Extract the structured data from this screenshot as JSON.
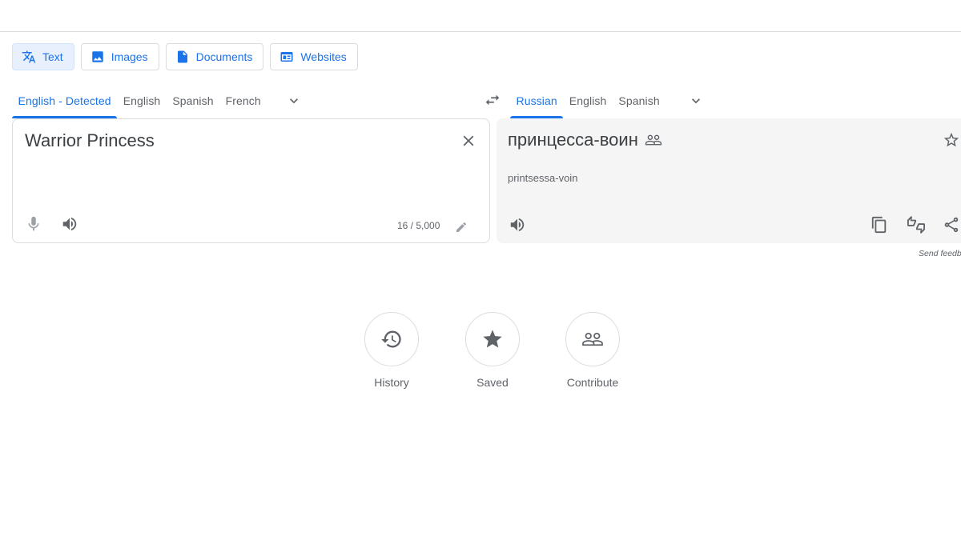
{
  "modes": [
    {
      "label": "Text",
      "icon": "translate-icon",
      "active": true
    },
    {
      "label": "Images",
      "icon": "image-icon",
      "active": false
    },
    {
      "label": "Documents",
      "icon": "document-icon",
      "active": false
    },
    {
      "label": "Websites",
      "icon": "website-icon",
      "active": false
    }
  ],
  "source_languages": [
    {
      "label": "English - Detected",
      "active": true
    },
    {
      "label": "English",
      "active": false
    },
    {
      "label": "Spanish",
      "active": false
    },
    {
      "label": "French",
      "active": false
    }
  ],
  "target_languages": [
    {
      "label": "Russian",
      "active": true
    },
    {
      "label": "English",
      "active": false
    },
    {
      "label": "Spanish",
      "active": false
    }
  ],
  "source": {
    "text": "Warrior Princess",
    "char_count": "16 / 5,000"
  },
  "target": {
    "text": "принцесса-воин",
    "transliteration": "printsessa-voin"
  },
  "feedback_label": "Send feedback",
  "shortcuts": [
    {
      "label": "History",
      "icon": "history-icon"
    },
    {
      "label": "Saved",
      "icon": "star-icon"
    },
    {
      "label": "Contribute",
      "icon": "people-icon"
    }
  ],
  "colors": {
    "accent": "#1a73e8",
    "active_tab_bg": "#e8f0fe",
    "target_panel_bg": "#f5f5f5",
    "icon_gray": "#5f6368",
    "border": "#dadce0"
  }
}
